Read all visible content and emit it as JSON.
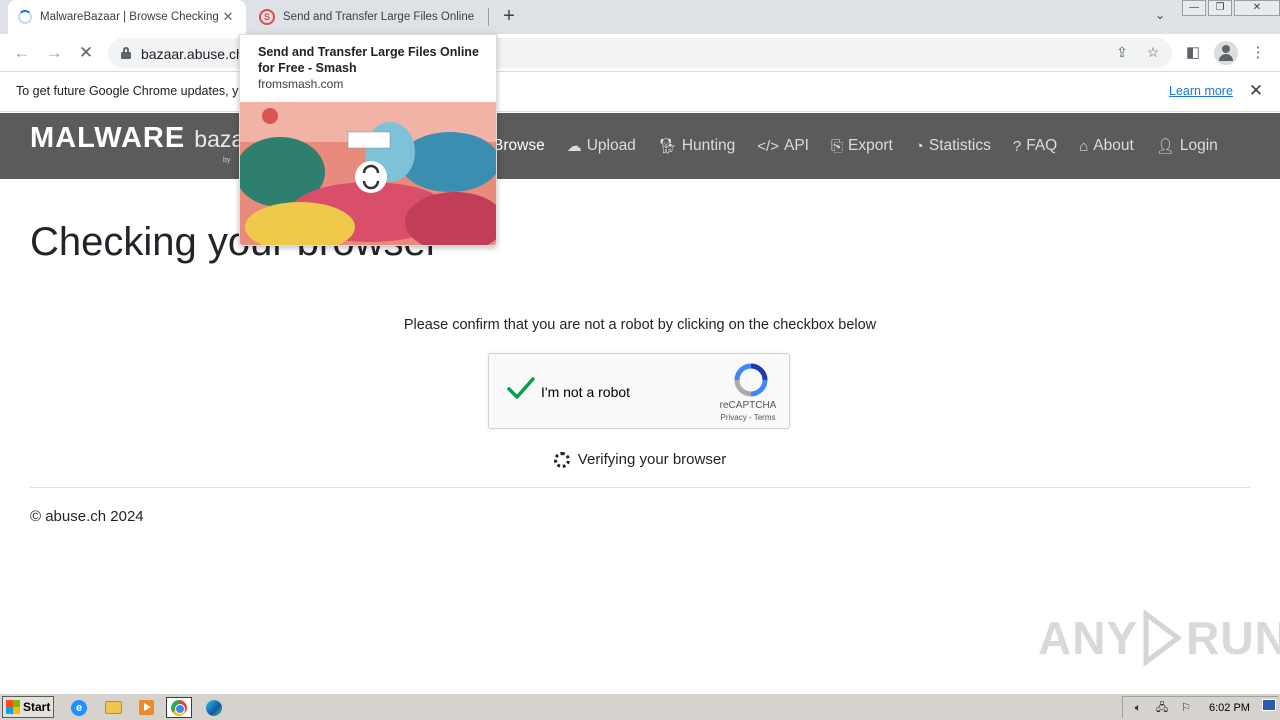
{
  "browser": {
    "tabs": [
      {
        "title": "MalwareBazaar | Browse Checking y"
      },
      {
        "title": "Send and Transfer Large Files Online"
      }
    ],
    "new_tab": "+",
    "tab_close": "✕",
    "url": "bazaar.abuse.ch"
  },
  "infobar": {
    "text": "To get future Google Chrome updates, y                                                             is using Windows 7.",
    "link": "Learn more",
    "close": "✕"
  },
  "hovercard": {
    "title": "Send and Transfer Large Files Online for Free - Smash",
    "domain": "fromsmash.com"
  },
  "site": {
    "logo_bold": "MALWARE",
    "logo_light": "bazaar",
    "logo_sub": "by",
    "nav": [
      {
        "label": "Browse",
        "icon": "browse-icon"
      },
      {
        "label": "Upload",
        "icon": "cloud-upload-icon"
      },
      {
        "label": "Hunting",
        "icon": "dog-icon"
      },
      {
        "label": "API",
        "icon": "code-icon"
      },
      {
        "label": "Export",
        "icon": "file-export-icon"
      },
      {
        "label": "Statistics",
        "icon": "pie-chart-icon"
      },
      {
        "label": "FAQ",
        "icon": "question-circle-icon"
      },
      {
        "label": "About",
        "icon": "building-icon"
      },
      {
        "label": "Login",
        "icon": "user-icon"
      }
    ]
  },
  "content": {
    "title": "Checking your browser",
    "instruction": "Please confirm that you are not a robot by clicking on the checkbox below",
    "recaptcha": {
      "label": "I'm not a robot",
      "brand": "reCAPTCHA",
      "terms": "Privacy - Terms",
      "checked": true
    },
    "verifying": "Verifying your browser",
    "footer": "© abuse.ch 2024"
  },
  "watermark": {
    "left": "ANY",
    "right": "RUN"
  },
  "taskbar": {
    "start": "Start",
    "clock": "6:02 PM"
  },
  "colors": {
    "header_bg": "#595b5c",
    "link": "#1a73e8",
    "check": "#0a9c4f"
  }
}
